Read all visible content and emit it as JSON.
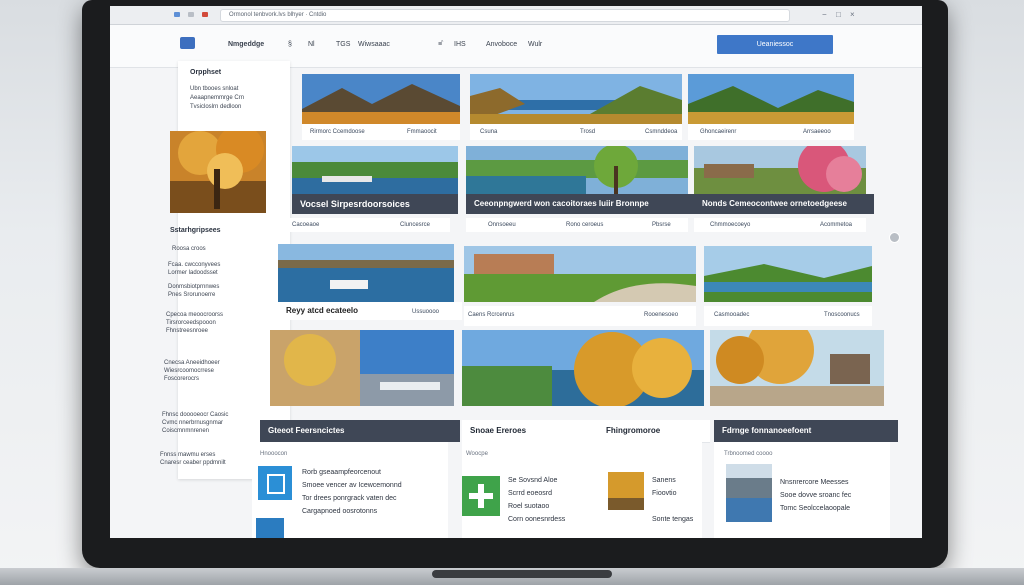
{
  "browser": {
    "url": "Ormonol tenbvork.lvs blhyer · Cntdio",
    "controls": [
      "−",
      "□",
      "×"
    ]
  },
  "topnav": {
    "brand": "Nmgeddge",
    "items": [
      "§",
      "Nl",
      "TGS",
      "Wiwsaaac",
      "≡̂",
      "IHS",
      "Anvoboce",
      "Wulr"
    ],
    "cta_label": "Ueaniessoc"
  },
  "sidebar": {
    "title": "Orpphset",
    "intro": [
      "Ubn tbooes snloat",
      "Aeaapnemmrge Crn",
      "Tvsicloslrn dedloon"
    ],
    "section_title": "Sstarhgripsees",
    "sub_title": "Roosa croos",
    "list_a": [
      "Fcaa. cwcconyvees",
      "Lormer ladoodsset",
      "Donmsbiotprnnwes",
      "Pnes Srorunoerre"
    ],
    "list_b": [
      "Cpecoa meoocroorss",
      "Tirsrorceedspooon",
      "Fhnstreesnroee"
    ],
    "list_c": [
      "Cnecsa Aneeidhoeer",
      "Wiesrcoomocrrese",
      "Foscorerocrs"
    ],
    "list_d": [
      "Fhnsc dooooeocr Caosic",
      "Cvmc nnerbrnusgnmar",
      "Coiscmnmnrenen"
    ],
    "list_e": [
      "Fnnss mawmu erses",
      "Cnaresr ceaber ppdmnilt"
    ]
  },
  "tiles": [
    {
      "caption_a": "Rirmorc Ccemdoose",
      "caption_b": "Fmmaoocit"
    },
    {
      "caption_a": "Csuna",
      "caption_b": "Trosd",
      "caption_c": "Csmnddeoa"
    },
    {
      "caption_a": "Ghoncaeirenr",
      "caption_b": "Arrsaeeoo"
    },
    {
      "band": "Vocsel Sirpesrdoorsoices",
      "caption_a": "Cacoeaoe",
      "caption_b": "Cluncesrce"
    },
    {
      "band": "Ceeonpngwerd won cacoitoraes  Iuiir Bronnpe",
      "caption_a": "Onnsoeeu",
      "caption_b": "Rono ceroeus",
      "caption_c": "Pbsrse"
    },
    {
      "band": "Nonds Cemeocontwee ornetoedgeese",
      "caption_a": "Chmmoecoeyo",
      "caption_b": "Acommetoa"
    },
    {
      "band": "Reyy atcd ecateelo",
      "caption_a": "Ussuoooo"
    },
    {
      "caption_a": "Caens Rcrcenrus",
      "caption_b": "Rooenesoeo"
    },
    {
      "caption_a": "Casmooadec",
      "caption_b": "Tnoscoonucs"
    }
  ],
  "bottom_sections": [
    {
      "title": "Gteeot Feersncictes",
      "sub": "Hnooocon",
      "lines": [
        "Rorb gseaampfeorcenout",
        "Smoee vencer av Icewcemonnd",
        "Tor drees ponrgrack vaten dec",
        "Cargapnoed oosrotonns"
      ]
    },
    {
      "title": "Snoae Ereroes",
      "sub": "Woocpe",
      "lines": [
        "Se Sovsnd Aloe",
        "Scrrd eoeosrd",
        "Roel suotaoo",
        "Corn oonesnrdess"
      ],
      "sub2": "Fhingromoroe",
      "lines2": [
        "Sanens",
        "Fioovtio",
        "Sonte tengas"
      ]
    },
    {
      "title": "Fdrnge fonnanoeefoent",
      "sub": "Trbnoomed coooo",
      "lines": [
        "Nnsnrercore Meesses",
        "Sooe dovve sroanc fec",
        "Tomc Seolccelaoopale"
      ]
    }
  ],
  "colors": {
    "accent": "#3e77c8",
    "band": "#3f4756",
    "monitor": "#1b1c1e"
  }
}
